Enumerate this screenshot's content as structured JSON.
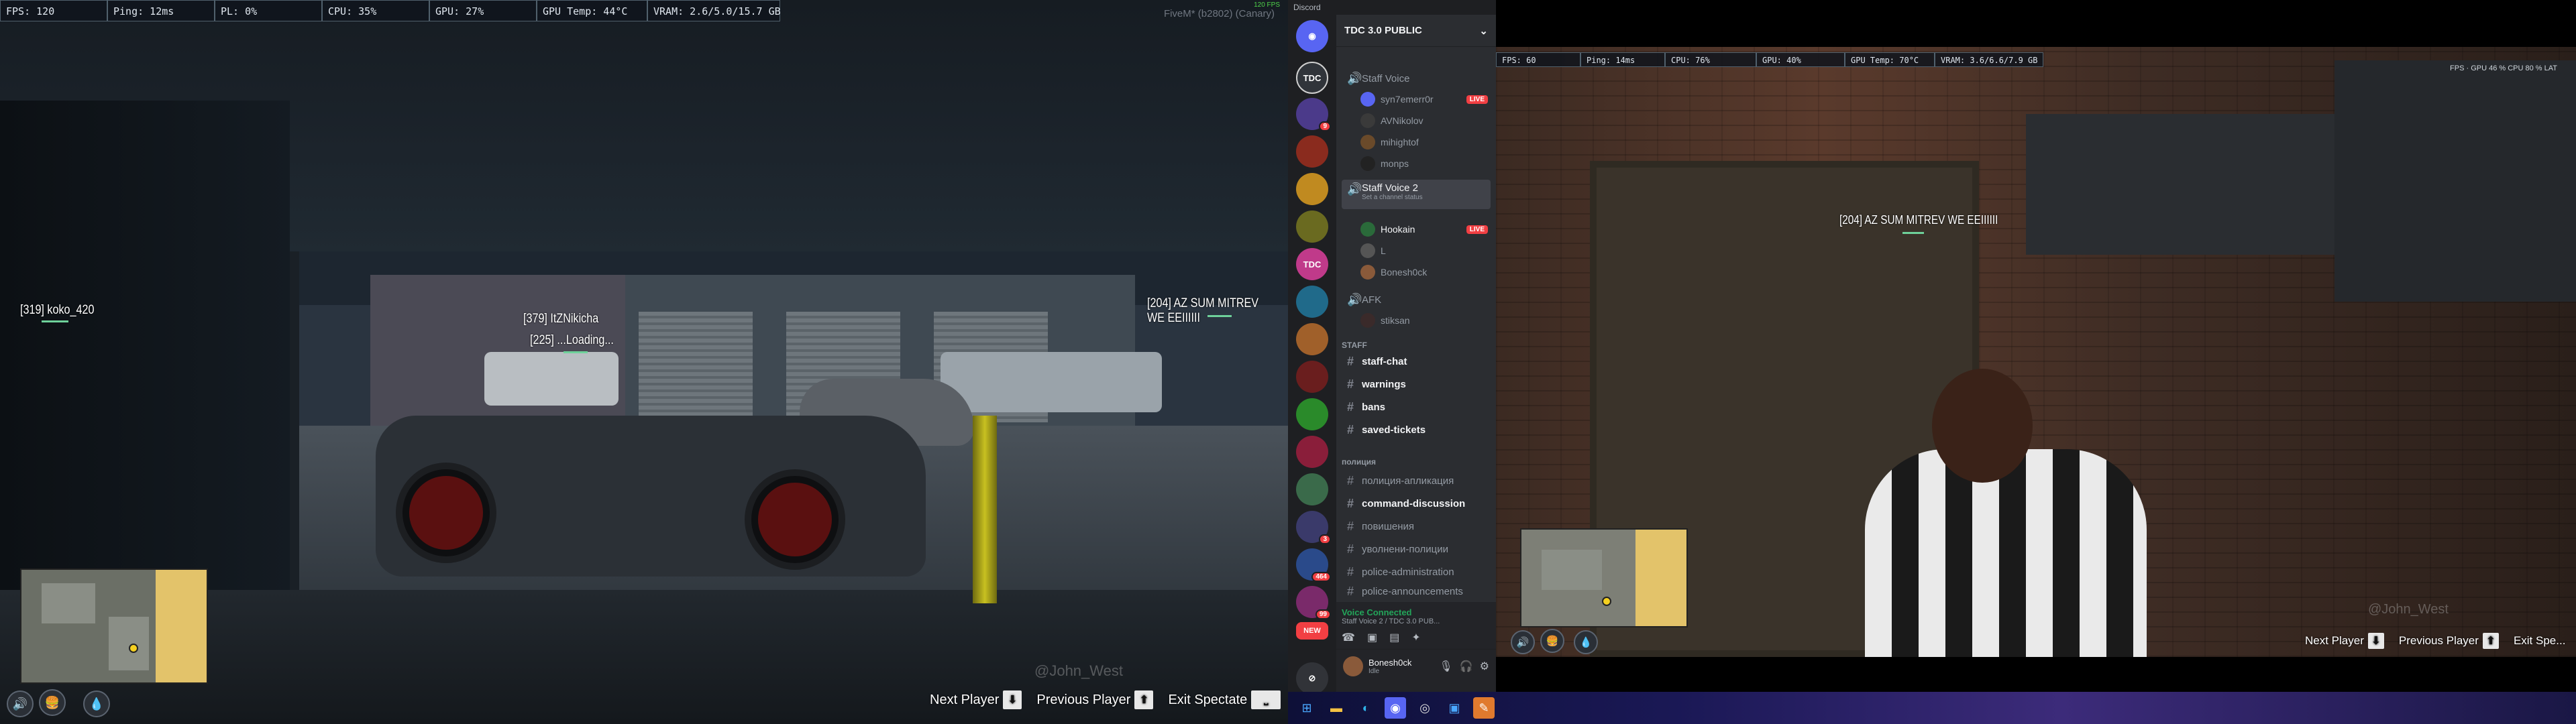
{
  "left_game": {
    "perf": [
      {
        "label": "FPS: 120"
      },
      {
        "label": "Ping: 12ms"
      },
      {
        "label": "PL: 0%"
      },
      {
        "label": "CPU: 35%"
      },
      {
        "label": "GPU: 27%"
      },
      {
        "label": "GPU Temp: 44°C"
      },
      {
        "label": "VRAM: 2.6/5.0/15.7 GB"
      }
    ],
    "build_label": "FiveM* (b2802) (Canary)",
    "fps_corner": "120 FPS",
    "nametags": [
      {
        "text": "[319] koko_420"
      },
      {
        "text": "[379] ItZNikicha"
      },
      {
        "text": "[225] ...Loading..."
      },
      {
        "text": "[204] AZ SUM MITREV WE EEIIIIII"
      }
    ],
    "watermark": "@John_West",
    "spectate": {
      "next_label": "Next Player",
      "next_key": "⬇",
      "prev_label": "Previous Player",
      "prev_key": "⬆",
      "exit_label": "Exit Spectate",
      "exit_key": "⎵"
    }
  },
  "discord": {
    "window_title": "Discord",
    "server_name": "TDC 3.0 PUBLIC",
    "rail_badges": [
      "9",
      "3",
      "464",
      "99",
      "NEW"
    ],
    "voice_channels": [
      {
        "name": "Staff Voice",
        "users": [
          "syn7emerr0r",
          "AVNikolov",
          "mihightof",
          "monps"
        ],
        "live_user": "syn7emerr0r"
      },
      {
        "name": "Staff Voice 2",
        "status": "Set a channel status",
        "users": [
          "Hookain",
          "L",
          "Bonesh0ck"
        ],
        "live_user": "Hookain"
      },
      {
        "name": "AFK",
        "users": [
          "stiksan"
        ]
      }
    ],
    "categories": [
      {
        "name": "STAFF",
        "channels": [
          "staff-chat",
          "warnings",
          "bans",
          "saved-tickets"
        ]
      },
      {
        "name": "полиция",
        "channels": [
          "полиция-апликация",
          "command-discussion",
          "повишения",
          "уволнени-полиции",
          "police-administration",
          "police-announcements"
        ]
      }
    ],
    "live_label": "LIVE",
    "voice_connected": "Voice Connected",
    "voice_location": "Staff Voice 2 / TDC 3.0 PUB...",
    "user": {
      "name": "Bonesh0ck",
      "status": "Idle"
    }
  },
  "right_game": {
    "perf": [
      {
        "label": "FPS: 60"
      },
      {
        "label": "Ping: 14ms"
      },
      {
        "label": "CPU: 76%"
      },
      {
        "label": "GPU: 40%"
      },
      {
        "label": "GPU Temp: 70°C"
      },
      {
        "label": "VRAM: 3.6/6.6/7.9 GB"
      }
    ],
    "top_right_stats": "FPS · GPU 46 % CPU 80 % LAT",
    "nametag": "[204] AZ SUM MITREV WE EEIIIIII",
    "watermark": "@John_West",
    "spectate": {
      "next_label": "Next Player",
      "next_key": "⬇",
      "prev_label": "Previous Player",
      "prev_key": "⬆",
      "exit_label": "Exit Spe..."
    }
  },
  "taskbar": {
    "icons": [
      "windows-start",
      "file-explorer",
      "edge-browser",
      "discord",
      "chrome",
      "store",
      "app-orange"
    ]
  }
}
